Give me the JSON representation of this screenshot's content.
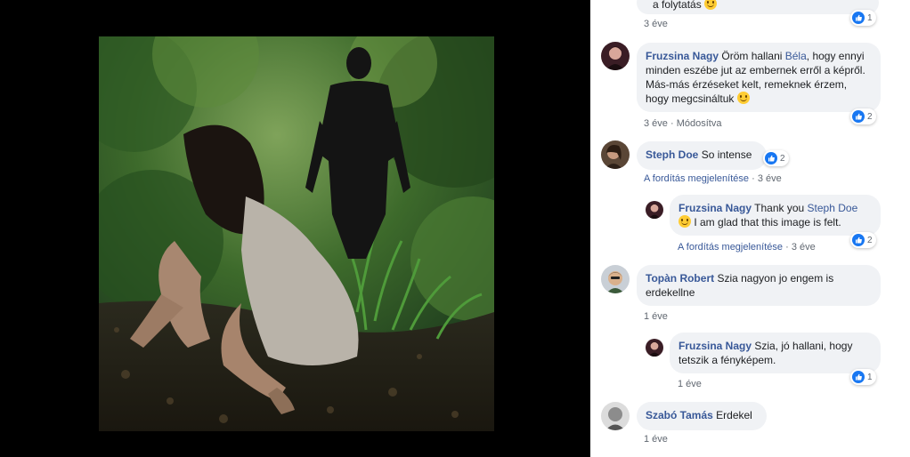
{
  "comments": [
    {
      "id": "c0",
      "text_tail": "a folytatás",
      "time": "3 éve",
      "reactions": "1"
    },
    {
      "id": "c1",
      "author": "Fruzsina Nagy",
      "text_a": "Öröm hallani",
      "mention": "Béla",
      "text_b": ", hogy ennyi minden eszébe jut az embernek erről a képről. Más-más érzéseket kelt, remeknek érzem, hogy megcsináltuk",
      "time": "3 éve",
      "edited": "Módosítva",
      "reactions": "2"
    },
    {
      "id": "c2",
      "author": "Steph Doe",
      "text": "So intense",
      "translate": "A fordítás megjelenítése",
      "time": "3 éve",
      "reactions": "2"
    },
    {
      "id": "c3",
      "author": "Fruzsina Nagy",
      "text_a": "Thank you",
      "mention": "Steph Doe",
      "text_b": "I am glad that this image is felt.",
      "translate": "A fordítás megjelenítése",
      "time": "3 éve",
      "reactions": "2"
    },
    {
      "id": "c4",
      "author": "Topàn Robert",
      "text": "Szia nagyon jo engem is erdekellne",
      "time": "1 éve"
    },
    {
      "id": "c5",
      "author": "Fruzsina Nagy",
      "text": "Szia, jó hallani, hogy tetszik a fényképem.",
      "time": "1 éve",
      "reactions": "1"
    },
    {
      "id": "c6",
      "author": "Szabó Tamás",
      "text": "Erdekel",
      "time": "1 éve"
    }
  ],
  "colors": {
    "link": "#385898",
    "bubble": "#f0f2f5",
    "like": "#1877f2",
    "meta": "#606770"
  }
}
